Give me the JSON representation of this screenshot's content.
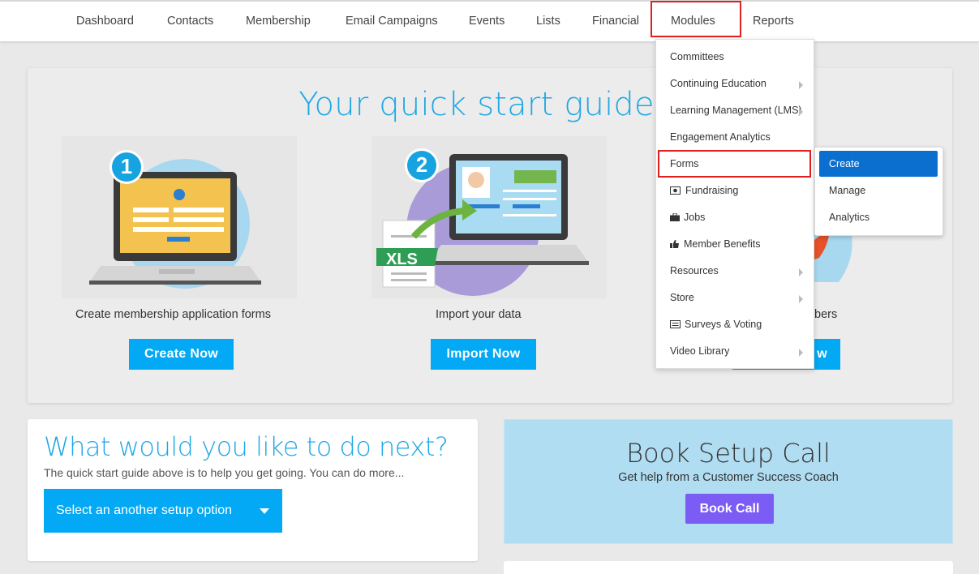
{
  "nav": {
    "items": [
      {
        "label": "Dashboard"
      },
      {
        "label": "Contacts"
      },
      {
        "label": "Membership"
      },
      {
        "label": "Email Campaigns"
      },
      {
        "label": "Events"
      },
      {
        "label": "Lists"
      },
      {
        "label": "Financial"
      },
      {
        "label": "Modules"
      },
      {
        "label": "Reports"
      }
    ]
  },
  "quick_start": {
    "title": "Your quick start guide",
    "steps": [
      {
        "number": "1",
        "label": "Create membership application forms",
        "button": "Create Now"
      },
      {
        "number": "2",
        "label": "Import your data",
        "button": "Import Now",
        "file_badge": "XLS"
      },
      {
        "label_visible": "bers",
        "button_visible": "w"
      }
    ]
  },
  "next": {
    "title": "What would you like to do next?",
    "subtitle": "The quick start guide above is to help you get going. You can do more...",
    "select_label": "Select an another setup option"
  },
  "book": {
    "title": "Book Setup Call",
    "subtitle": "Get help from a Customer Success Coach",
    "button": "Book Call"
  },
  "modules_menu": {
    "items": [
      {
        "label": "Committees",
        "icon": "",
        "submenu": false
      },
      {
        "label": "Continuing Education",
        "icon": "",
        "submenu": true
      },
      {
        "label": "Learning Management (LMS)",
        "icon": "",
        "submenu": true
      },
      {
        "label": "Engagement Analytics",
        "icon": "",
        "submenu": false
      },
      {
        "label": "Forms",
        "icon": "",
        "submenu": true
      },
      {
        "label": "Fundraising",
        "icon": "money-icon",
        "submenu": false
      },
      {
        "label": "Jobs",
        "icon": "briefcase-icon",
        "submenu": false
      },
      {
        "label": "Member Benefits",
        "icon": "thumbs-up-icon",
        "submenu": false
      },
      {
        "label": "Resources",
        "icon": "",
        "submenu": true
      },
      {
        "label": "Store",
        "icon": "",
        "submenu": true
      },
      {
        "label": "Surveys & Voting",
        "icon": "list-icon",
        "submenu": false
      },
      {
        "label": "Video Library",
        "icon": "",
        "submenu": true
      }
    ]
  },
  "forms_submenu": {
    "items": [
      {
        "label": "Create",
        "active": true
      },
      {
        "label": "Manage"
      },
      {
        "label": "Analytics"
      }
    ]
  },
  "colors": {
    "accent": "#03a9f4",
    "title_blue": "#1ea7e4",
    "book_bg": "#b0ddf2",
    "book_button": "#7b5cf5",
    "highlight_box": "#e02020",
    "submenu_active": "#0b6fd0"
  }
}
